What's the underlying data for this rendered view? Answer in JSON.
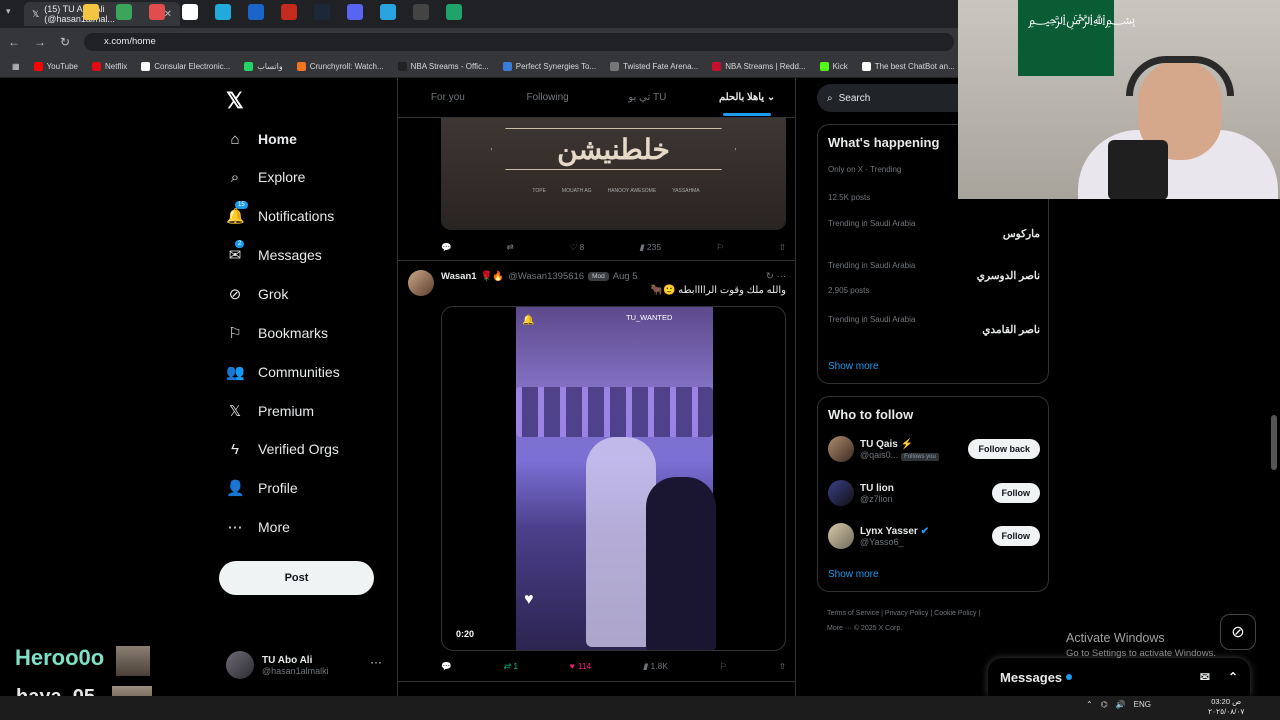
{
  "browser": {
    "tab_title": "(15) TU Abo Ali (@hasan1almal...",
    "url": "x.com/home",
    "bookmarks": [
      {
        "label": "YouTube",
        "color": "#ff0000"
      },
      {
        "label": "Netflix",
        "color": "#e50914"
      },
      {
        "label": "Consular Electronic...",
        "color": "#ffffff"
      },
      {
        "label": "واتساب",
        "color": "#25d366"
      },
      {
        "label": "Crunchyroll: Watch...",
        "color": "#f47521"
      },
      {
        "label": "NBA Streams - Offic...",
        "color": "#222222"
      },
      {
        "label": "Perfect Synergies To...",
        "color": "#3a7bd5"
      },
      {
        "label": "Twisted Fate Arena...",
        "color": "#777777"
      },
      {
        "label": "NBA Streams | Redd...",
        "color": "#c8102e"
      },
      {
        "label": "Kick",
        "color": "#53fc18"
      },
      {
        "label": "The best ChatBot an...",
        "color": "#ffffff"
      }
    ]
  },
  "nav": {
    "items": [
      {
        "label": "Home",
        "icon": "home-icon",
        "glyph": "⌂"
      },
      {
        "label": "Explore",
        "icon": "search-icon",
        "glyph": "⌕"
      },
      {
        "label": "Notifications",
        "icon": "bell-icon",
        "glyph": "🔔",
        "badge": "15"
      },
      {
        "label": "Messages",
        "icon": "mail-icon",
        "glyph": "✉",
        "badge": "2"
      },
      {
        "label": "Grok",
        "icon": "grok-icon",
        "glyph": "⊘"
      },
      {
        "label": "Bookmarks",
        "icon": "bookmark-icon",
        "glyph": "⚐"
      },
      {
        "label": "Communities",
        "icon": "people-icon",
        "glyph": "👥"
      },
      {
        "label": "Premium",
        "icon": "x-icon",
        "glyph": "𝕏"
      },
      {
        "label": "Verified Orgs",
        "icon": "lightning-icon",
        "glyph": "ϟ"
      },
      {
        "label": "Profile",
        "icon": "person-icon",
        "glyph": "👤"
      },
      {
        "label": "More",
        "icon": "more-icon",
        "glyph": "⋯"
      }
    ],
    "post_label": "Post",
    "account": {
      "name": "TU Abo Ali",
      "handle": "@hasan1almalki"
    }
  },
  "feed": {
    "tabs": [
      "For you",
      "Following",
      "تي يو TU",
      "ياهلا بالحلم"
    ],
    "banner_text": "خلطنيشن",
    "banner_strip": [
      "TOPE",
      "MOUATH AG",
      "HANOOY AWESOME",
      "YASSAHMA"
    ],
    "tweet1": {
      "likes": "8",
      "views": "235"
    },
    "tweet2": {
      "name": "Wasan1",
      "emoji": "🌹🔥",
      "handle": "@Wasan1395616",
      "badge": "Mod",
      "date": "Aug 5",
      "text": "والله ملك وقوت الراااابطه 🙂🐂",
      "video_label": "TU_WANTED",
      "video_time": "0:20",
      "retweets": "1",
      "likes": "114",
      "views": "1.8K"
    }
  },
  "sidebar": {
    "search_placeholder": "Search",
    "trends_title": "What's happening",
    "trends": [
      {
        "context": "Only on X · Trending",
        "topic": "",
        "posts": "12.5K posts"
      },
      {
        "context": "Trending in Saudi Arabia",
        "topic": "ماركوس",
        "posts": ""
      },
      {
        "context": "Trending in Saudi Arabia",
        "topic": "ناصر الدوسري",
        "posts": "2,905 posts"
      },
      {
        "context": "Trending in Saudi Arabia",
        "topic": "ناصر القامدي",
        "posts": ""
      }
    ],
    "show_more": "Show more",
    "follow_title": "Who to follow",
    "follow": [
      {
        "name": "TU Qais ⚡",
        "handle": "@qais0...",
        "follows_you": "Follows you",
        "button": "Follow back"
      },
      {
        "name": "TU lion",
        "handle": "@z7lion",
        "follows_you": "",
        "button": "Follow"
      },
      {
        "name": "Lynx Yasser",
        "handle": "@Yasso6_",
        "follows_you": "",
        "button": "Follow"
      }
    ],
    "footer": [
      "Terms of Service",
      "Privacy Policy",
      "Cookie Policy",
      "More ···",
      "© 2025 X Corp."
    ]
  },
  "messages_drawer": "Messages",
  "watermark": {
    "title": "Activate Windows",
    "subtitle": "Go to Settings to activate Windows."
  },
  "stream": {
    "user1": "Heroo0o",
    "user2": "haya_05"
  },
  "taskbar": {
    "lang": "ENG",
    "time": "03:20 ص",
    "date": "٢٠٢٥/٠٨/٠٧"
  }
}
